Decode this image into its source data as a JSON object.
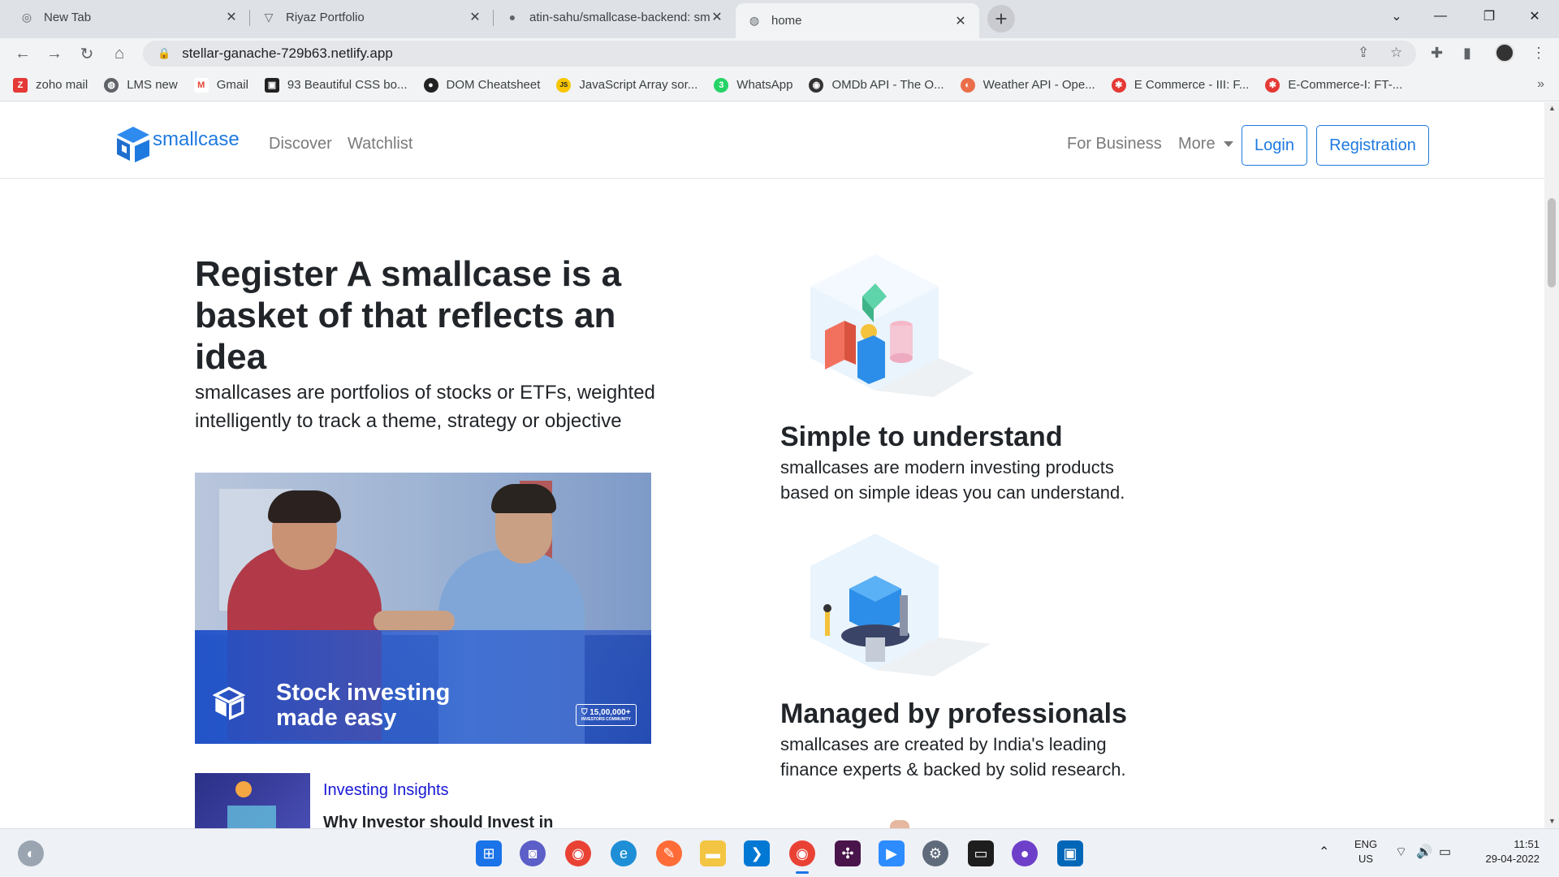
{
  "browser": {
    "tabs": [
      {
        "title": "New Tab",
        "icon": "chrome-icon"
      },
      {
        "title": "Riyaz Portfolio",
        "icon": "vercel-icon"
      },
      {
        "title": "atin-sahu/smallcase-backend: sm",
        "icon": "github-icon"
      },
      {
        "title": "home",
        "icon": "globe-icon"
      }
    ],
    "url": "stellar-ganache-729b63.netlify.app",
    "bookmarks": [
      {
        "label": "zoho mail",
        "color": "#e53935",
        "glyph": "Z"
      },
      {
        "label": "LMS new",
        "color": "#5f6368",
        "glyph": "◍"
      },
      {
        "label": "Gmail",
        "color": "#ffffff",
        "glyph": "M"
      },
      {
        "label": "93 Beautiful CSS bo...",
        "color": "#222222",
        "glyph": "▣"
      },
      {
        "label": "DOM Cheatsheet",
        "color": "#222222",
        "glyph": "●"
      },
      {
        "label": "JavaScript Array sor...",
        "color": "#f7c600",
        "glyph": "JS"
      },
      {
        "label": "WhatsApp",
        "color": "#25d366",
        "glyph": "3"
      },
      {
        "label": "OMDb API - The O...",
        "color": "#333333",
        "glyph": "◉"
      },
      {
        "label": "Weather API - Ope...",
        "color": "#eb6e4b",
        "glyph": "◐"
      },
      {
        "label": "E Commerce - III: F...",
        "color": "#e53935",
        "glyph": "✱"
      },
      {
        "label": "E-Commerce-I: FT-...",
        "color": "#e53935",
        "glyph": "✱"
      }
    ]
  },
  "site": {
    "brand": "smallcase",
    "nav": {
      "discover": "Discover",
      "watchlist": "Watchlist",
      "for_business": "For Business",
      "more": "More",
      "login": "Login",
      "registration": "Registration"
    },
    "hero": {
      "title": "Register A smallcase is a basket of that reflects an idea",
      "subtitle": "smallcases are portfolios of stocks or ETFs, weighted intelligently to track a theme, strategy or objective",
      "image_caption_line1": "Stock investing",
      "image_caption_line2": "made easy",
      "image_badge": "15,00,000+",
      "image_badge_sub": "INVESTORS COMMUNITY"
    },
    "insight": {
      "category": "Investing Insights",
      "title": "Why Investor should Invest in"
    },
    "features": [
      {
        "title": "Simple to understand",
        "desc": "smallcases are modern investing products based on simple ideas you can understand."
      },
      {
        "title": "Managed by professionals",
        "desc": "smallcases are created by India's leading finance experts & backed by solid research."
      }
    ],
    "colors": {
      "accent": "#1f7ae0",
      "link": "#1717d6"
    }
  },
  "taskbar": {
    "apps": [
      "windows-icon",
      "teams-icon",
      "chrome-icon",
      "edge-icon",
      "postman-icon",
      "file-explorer-icon",
      "vscode-icon",
      "chrome-active-icon",
      "slack-icon",
      "zoom-icon",
      "settings-icon",
      "terminal-icon",
      "github-desktop-icon",
      "remote-desktop-icon"
    ],
    "lang": "ENG",
    "region": "US",
    "time": "11:51",
    "date": "29-04-2022"
  }
}
